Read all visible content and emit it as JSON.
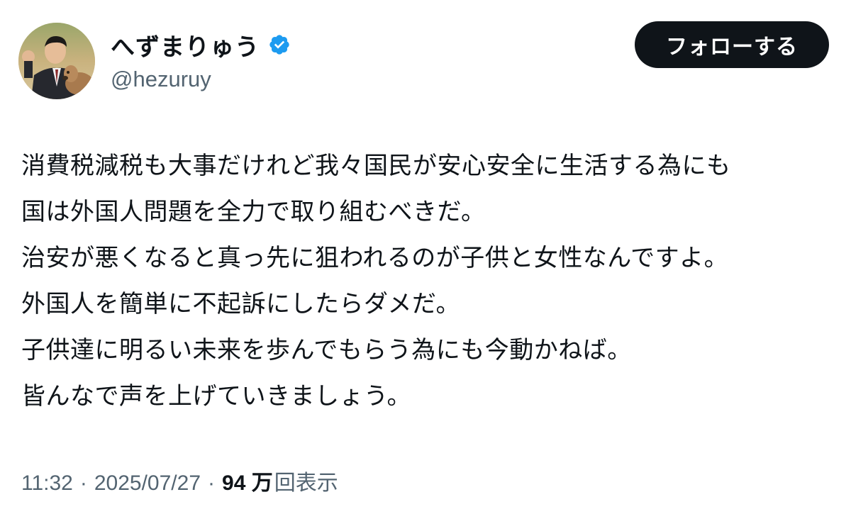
{
  "user": {
    "display_name": "へずまりゅう",
    "handle": "@hezuruy",
    "verified": true,
    "verified_color": "#1d9bf0"
  },
  "follow_button": {
    "label": "フォローする",
    "background": "#0f1419"
  },
  "tweet": {
    "lines": [
      "消費税減税も大事だけれど我々国民が安心安全に生活する為にも",
      "国は外国人問題を全力で取り組むべきだ。",
      "治安が悪くなると真っ先に狙われるのが子供と女性なんですよ。",
      "外国人を簡単に不起訴にしたらダメだ。",
      "子供達に明るい未来を歩んでもらう為にも今動かねば。",
      "皆んなで声を上げていきましょう。"
    ]
  },
  "meta": {
    "time": "11:32",
    "separator": "·",
    "date": "2025/07/27",
    "views_count": "94 万",
    "views_label": "回表示"
  }
}
